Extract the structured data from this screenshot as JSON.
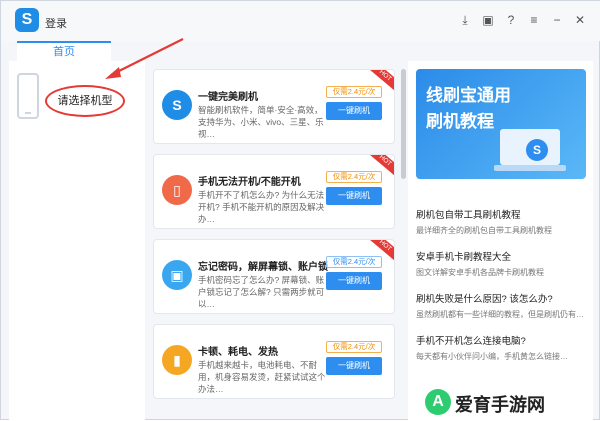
{
  "app": {
    "title": "登录"
  },
  "tabs": [
    {
      "label": "首页"
    }
  ],
  "left": {
    "select_model": "请选择机型"
  },
  "cards": [
    {
      "title": "一键完美刷机",
      "desc": "智能刷机软件，简单·安全·高效，支持华为、小米、vivo、三星、乐视…",
      "price": "仅需2.4元/次",
      "price_color": "orange",
      "button": "一键刷机",
      "badge": "HOT",
      "icon": "lightning-logo"
    },
    {
      "title": "手机无法开机/不能开机",
      "desc": "手机开不了机怎么办? 为什么无法开机? 手机不能开机的原因及解决办…",
      "price": "仅需2.4元/次",
      "price_color": "orange",
      "button": "一键刷机",
      "badge": "HOT",
      "icon": "phone-icon"
    },
    {
      "title": "忘记密码，解屏幕锁、账户锁",
      "desc": "手机密码忘了怎么办? 屏幕锁、账户锁忘记了怎么解? 只需两步就可以…",
      "price": "仅需2.4元/次",
      "price_color": "blue",
      "button": "一键刷机",
      "badge": "HOT",
      "icon": "lock-phone-icon"
    },
    {
      "title": "卡顿、耗电、发热",
      "desc": "手机越来越卡，电池耗电、不耐用，机身容易发烫，赶紧试试这个办法…",
      "price": "仅需2.4元/次",
      "price_color": "orange",
      "button": "一键刷机",
      "badge": "",
      "icon": "battery-icon"
    }
  ],
  "banner": {
    "line1": "线刷宝通用",
    "line2": "刷机教程"
  },
  "articles": [
    {
      "title": "刷机包自带工具刷机教程",
      "desc": "最详细齐全的刷机包自带工具刷机教程"
    },
    {
      "title": "安卓手机卡刷教程大全",
      "desc": "图文详解安卓手机各品牌卡刷机教程"
    },
    {
      "title": "刷机失败是什么原因? 该怎么办?",
      "desc": "虽然刷机都有一些详细的教程，但是刷机仍有…"
    },
    {
      "title": "手机不开机怎么连接电脑?",
      "desc": "每天都有小伙伴问小编，手机黄怎么链接…"
    }
  ],
  "watermark": {
    "text": "爱育手游网"
  },
  "colors": {
    "accent": "#2d8ef0",
    "hot": "#e53935",
    "price_orange": "#f08c00"
  }
}
